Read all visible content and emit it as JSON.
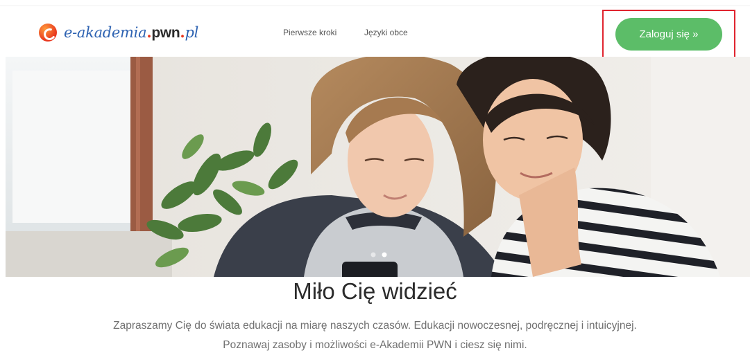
{
  "header": {
    "logo": {
      "prefix": "e-akademia",
      "dot1": ".",
      "brand": "pwn",
      "dot2": ".",
      "suffix": "pl"
    },
    "nav": [
      {
        "label": "Pierwsze kroki"
      },
      {
        "label": "Języki obce"
      }
    ],
    "login_label": "Zaloguj się »"
  },
  "hero": {
    "carousel": {
      "slides": 2,
      "active_index": 1
    }
  },
  "main": {
    "title": "Miło Cię widzieć",
    "lead_line1": "Zapraszamy Cię do świata edukacji na miarę naszych czasów. Edukacji nowoczesnej, podręcznej i intuicyjnej.",
    "lead_line2": "Poznawaj zasoby i możliwości e-Akademii PWN i ciesz się nimi."
  },
  "colors": {
    "accent_green": "#5cbd68",
    "highlight_red": "#e0242f",
    "brand_blue": "#2e63b2",
    "brand_orange": "#e8351d"
  },
  "icons": [
    "e-logo-icon",
    "carousel-dot-icon"
  ]
}
